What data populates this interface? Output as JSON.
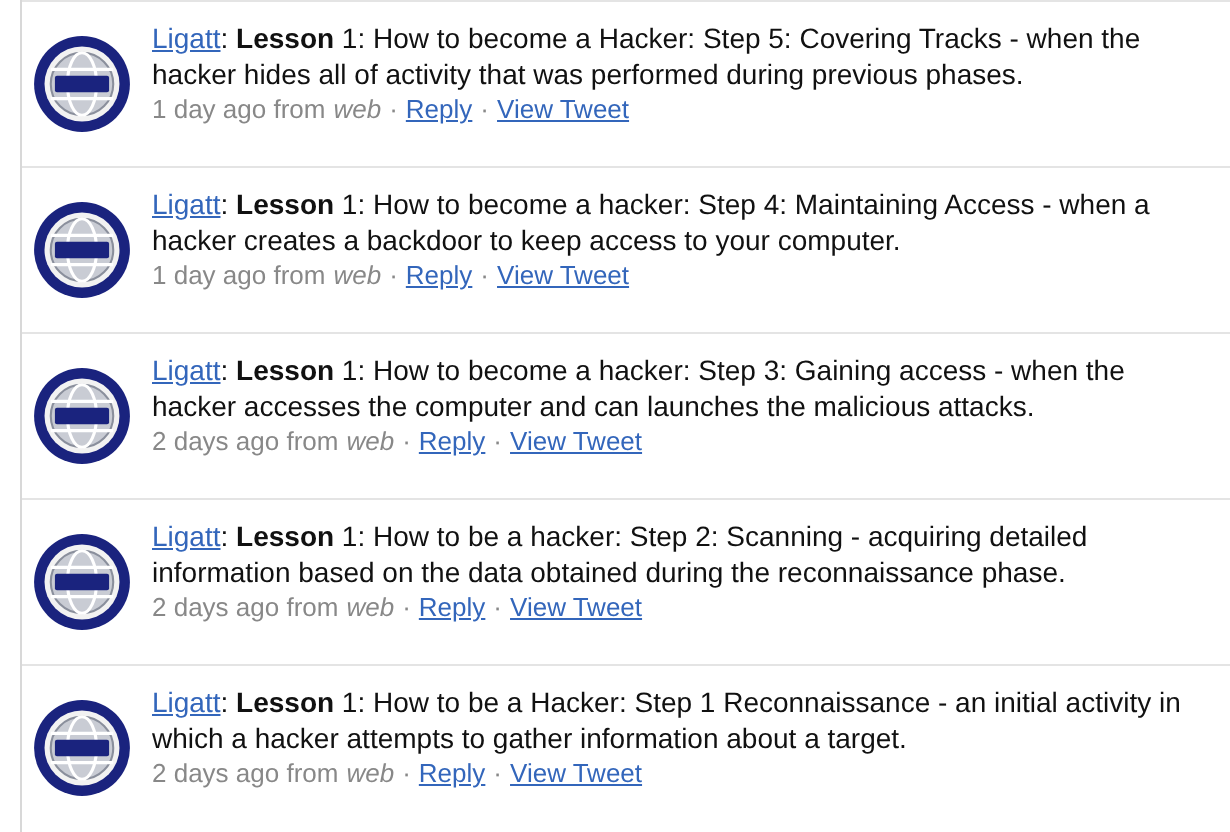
{
  "tweets": [
    {
      "author": "Ligatt",
      "text": ": **Lesson** 1: How to become a Hacker: Step 5: Covering Tracks - when the hacker hides all of activity that was performed during previous phases.",
      "time": "1 day ago from",
      "source": "web",
      "separator_1": "·",
      "reply": "Reply",
      "separator_2": "·",
      "view": "View Tweet"
    },
    {
      "author": "Ligatt",
      "text": ": **Lesson** 1: How to become a hacker: Step 4: Maintaining Access - when a hacker creates a backdoor to keep access to your computer.",
      "time": "1 day ago from",
      "source": "web",
      "separator_1": "·",
      "reply": "Reply",
      "separator_2": "·",
      "view": "View Tweet"
    },
    {
      "author": "Ligatt",
      "text": ": **Lesson** 1: How to become a hacker: Step 3: Gaining access - when the hacker accesses the computer and can launches the malicious attacks.",
      "time": "2 days ago from",
      "source": "web",
      "separator_1": "·",
      "reply": "Reply",
      "separator_2": "·",
      "view": "View Tweet"
    },
    {
      "author": "Ligatt",
      "text": ": **Lesson** 1: How to be a hacker: Step 2: Scanning - acquiring detailed information based on the data obtained during the reconnaissance phase.",
      "time": "2 days ago from",
      "source": "web",
      "separator_1": "·",
      "reply": "Reply",
      "separator_2": "·",
      "view": "View Tweet"
    },
    {
      "author": "Ligatt",
      "text": ": **Lesson** 1: How to be a Hacker: Step 1 Reconnaissance - an initial activity in which a hacker attempts to gather information about a target.",
      "time": "2 days ago from",
      "source": "web",
      "separator_1": "·",
      "reply": "Reply",
      "separator_2": "·",
      "view": "View Tweet"
    }
  ]
}
